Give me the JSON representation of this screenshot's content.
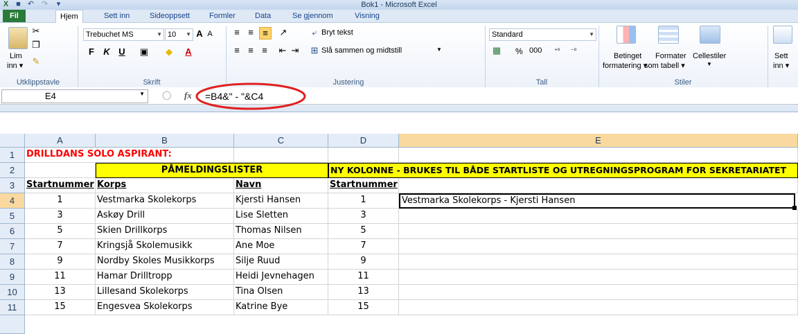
{
  "window": {
    "title": "Bok1 - Microsoft Excel"
  },
  "tabs": [
    "Fil",
    "Hjem",
    "Sett inn",
    "Sideoppsett",
    "Formler",
    "Data",
    "Se gjennom",
    "Visning"
  ],
  "ribbon": {
    "clipboard": {
      "paste_line1": "Lim",
      "paste_line2": "inn ▾",
      "group": "Utklippstavle"
    },
    "font": {
      "name": "Trebuchet MS",
      "size": "10",
      "bold": "F",
      "italic": "K",
      "underline": "U",
      "group": "Skrift"
    },
    "alignment": {
      "wrap": "Bryt tekst",
      "merge": "Slå sammen og midtstill",
      "group": "Justering"
    },
    "number": {
      "format": "Standard",
      "percent": "%",
      "thousands": "000",
      "group": "Tall"
    },
    "styles": {
      "cond1": "Betinget",
      "cond2": "formatering ▾",
      "table1": "Formater",
      "table2": "som tabell ▾",
      "cell": "Cellestiler",
      "group": "Stiler"
    },
    "cells": {
      "insert1": "Sett",
      "insert2": "inn ▾"
    }
  },
  "formula_bar": {
    "name_box": "E4",
    "fx": "fx",
    "formula": "=B4&\" - \"&C4"
  },
  "columns": [
    "A",
    "B",
    "C",
    "D",
    "E"
  ],
  "rows": [
    {
      "n": "1",
      "A": "DRILLDANS SOLO ASPIRANT:"
    },
    {
      "n": "2",
      "B": "PÅMELDINGSLISTER",
      "D": "NY KOLONNE - BRUKES TIL BÅDE STARTLISTE OG UTREGNINGSPROGRAM FOR SEKRETARIATET"
    },
    {
      "n": "3",
      "A": "Startnummer",
      "B": "Korps",
      "C": "Navn",
      "D": "Startnummer"
    },
    {
      "n": "4",
      "A": "1",
      "B": "Vestmarka Skolekorps",
      "C": "Kjersti Hansen",
      "D": "1",
      "E": "Vestmarka Skolekorps - Kjersti Hansen"
    },
    {
      "n": "5",
      "A": "3",
      "B": "Askøy Drill",
      "C": "Lise Sletten",
      "D": "3"
    },
    {
      "n": "6",
      "A": "5",
      "B": "Skien Drillkorps",
      "C": "Thomas Nilsen",
      "D": "5"
    },
    {
      "n": "7",
      "A": "7",
      "B": "Kringsjå Skolemusikk",
      "C": "Ane Moe",
      "D": "7"
    },
    {
      "n": "8",
      "A": "9",
      "B": "Nordby Skoles Musikkorps",
      "C": "Silje Ruud",
      "D": "9"
    },
    {
      "n": "9",
      "A": "11",
      "B": "Hamar Drilltropp",
      "C": "Heidi Jevnehagen",
      "D": "11"
    },
    {
      "n": "10",
      "A": "13",
      "B": "Lillesand Skolekorps",
      "C": "Tina Olsen",
      "D": "13"
    },
    {
      "n": "11",
      "A": "15",
      "B": "Engesvea Skolekorps",
      "C": "Katrine Bye",
      "D": "15"
    }
  ],
  "colors": {
    "accent_yellow": "#ffff00",
    "title_red": "#ff0000",
    "annotation": "#e02020",
    "selected_header": "#f9d99f"
  }
}
